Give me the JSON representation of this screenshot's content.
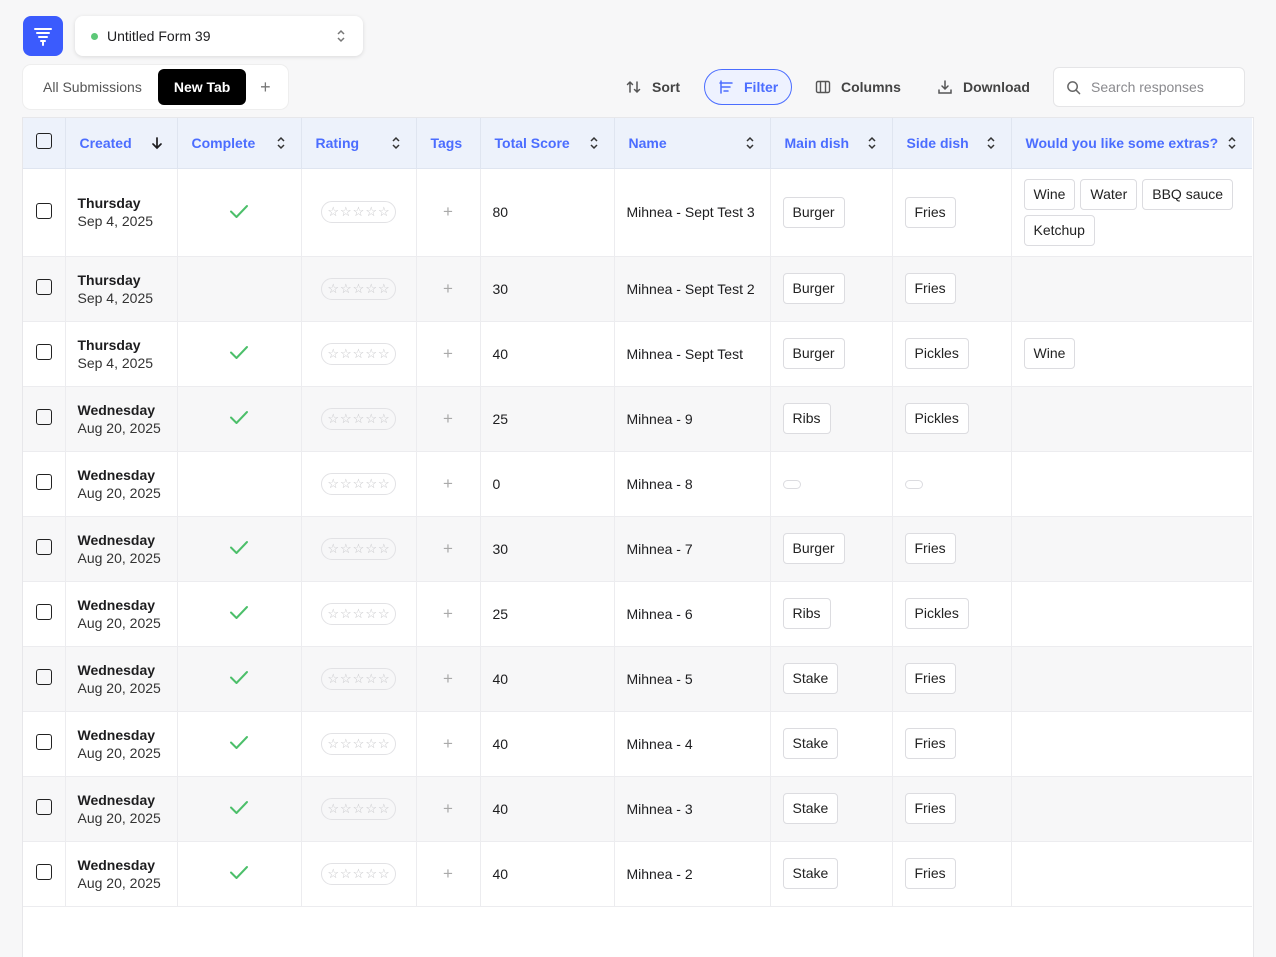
{
  "header": {
    "logo_icon": "funnel-logo-icon",
    "form_title": "Untitled Form 39",
    "status_color": "#5dc878"
  },
  "tabs": {
    "all": "All Submissions",
    "new": "New Tab",
    "add": "+"
  },
  "toolbar": {
    "sort": "Sort",
    "filter": "Filter",
    "columns": "Columns",
    "download": "Download",
    "search_placeholder": "Search responses"
  },
  "columns": {
    "created": "Created",
    "complete": "Complete",
    "rating": "Rating",
    "tags": "Tags",
    "score": "Total Score",
    "name": "Name",
    "main": "Main dish",
    "side": "Side dish",
    "extras": "Would you like some extras?"
  },
  "rows": [
    {
      "day": "Thursday",
      "date": "Sep 4, 2025",
      "complete": true,
      "score": "80",
      "name": "Mihnea - Sept Test 3",
      "main": "Burger",
      "side": "Fries",
      "extras": [
        "Wine",
        "Water",
        "BBQ sauce",
        "Ketchup"
      ]
    },
    {
      "day": "Thursday",
      "date": "Sep 4, 2025",
      "complete": false,
      "score": "30",
      "name": "Mihnea - Sept Test 2",
      "main": "Burger",
      "side": "Fries",
      "extras": []
    },
    {
      "day": "Thursday",
      "date": "Sep 4, 2025",
      "complete": true,
      "score": "40",
      "name": "Mihnea - Sept Test",
      "main": "Burger",
      "side": "Pickles",
      "extras": [
        "Wine"
      ]
    },
    {
      "day": "Wednesday",
      "date": "Aug 20, 2025",
      "complete": true,
      "score": "25",
      "name": "Mihnea - 9",
      "main": "Ribs",
      "side": "Pickles",
      "extras": []
    },
    {
      "day": "Wednesday",
      "date": "Aug 20, 2025",
      "complete": false,
      "score": "0",
      "name": "Mihnea - 8",
      "main": "",
      "side": "",
      "extras": []
    },
    {
      "day": "Wednesday",
      "date": "Aug 20, 2025",
      "complete": true,
      "score": "30",
      "name": "Mihnea - 7",
      "main": "Burger",
      "side": "Fries",
      "extras": []
    },
    {
      "day": "Wednesday",
      "date": "Aug 20, 2025",
      "complete": true,
      "score": "25",
      "name": "Mihnea - 6",
      "main": "Ribs",
      "side": "Pickles",
      "extras": []
    },
    {
      "day": "Wednesday",
      "date": "Aug 20, 2025",
      "complete": true,
      "score": "40",
      "name": "Mihnea - 5",
      "main": "Stake",
      "side": "Fries",
      "extras": []
    },
    {
      "day": "Wednesday",
      "date": "Aug 20, 2025",
      "complete": true,
      "score": "40",
      "name": "Mihnea - 4",
      "main": "Stake",
      "side": "Fries",
      "extras": []
    },
    {
      "day": "Wednesday",
      "date": "Aug 20, 2025",
      "complete": true,
      "score": "40",
      "name": "Mihnea - 3",
      "main": "Stake",
      "side": "Fries",
      "extras": []
    },
    {
      "day": "Wednesday",
      "date": "Aug 20, 2025",
      "complete": true,
      "score": "40",
      "name": "Mihnea - 2",
      "main": "Stake",
      "side": "Fries",
      "extras": []
    }
  ],
  "colors": {
    "accent": "#4b6dff",
    "check": "#4cbf6a"
  }
}
